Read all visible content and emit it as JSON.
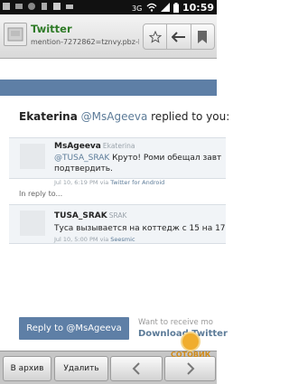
{
  "status_bar": {
    "time": "10:59"
  },
  "browser": {
    "page_title": "Twitter",
    "url": "mention-7272862=tznvy.pbz-b..."
  },
  "tweet_headline": {
    "user": "Ekaterina",
    "handle": "@MsAgeeva",
    "action": "replied to you:"
  },
  "reply_tweet": {
    "name": "MsAgeeva",
    "fullname": "Ekaterina",
    "mention": "@TUSA_SRAK",
    "text_line1": "Круто! Роми обещал завт",
    "text_line2": "подтвердить.",
    "meta": "Jul 10, 6:19 PM via",
    "via": "Twitter for Android"
  },
  "in_reply_to_label": "In reply to...",
  "original_tweet": {
    "name": "TUSA_SRAK",
    "fullname": "SRAK",
    "text": "Туса вызывается на коттедж с 15 на 17",
    "meta": "Jul 10, 5:00 PM via",
    "via": "Seesmic"
  },
  "reply_button": "Reply to @MsAgeeva",
  "promo": {
    "want_text": "Want to receive mo",
    "download_text": "Download Twitter"
  },
  "bottom_bar": {
    "archive_label": "В архив",
    "delete_label": "Удалить"
  },
  "watermark": "СОТОВИК"
}
